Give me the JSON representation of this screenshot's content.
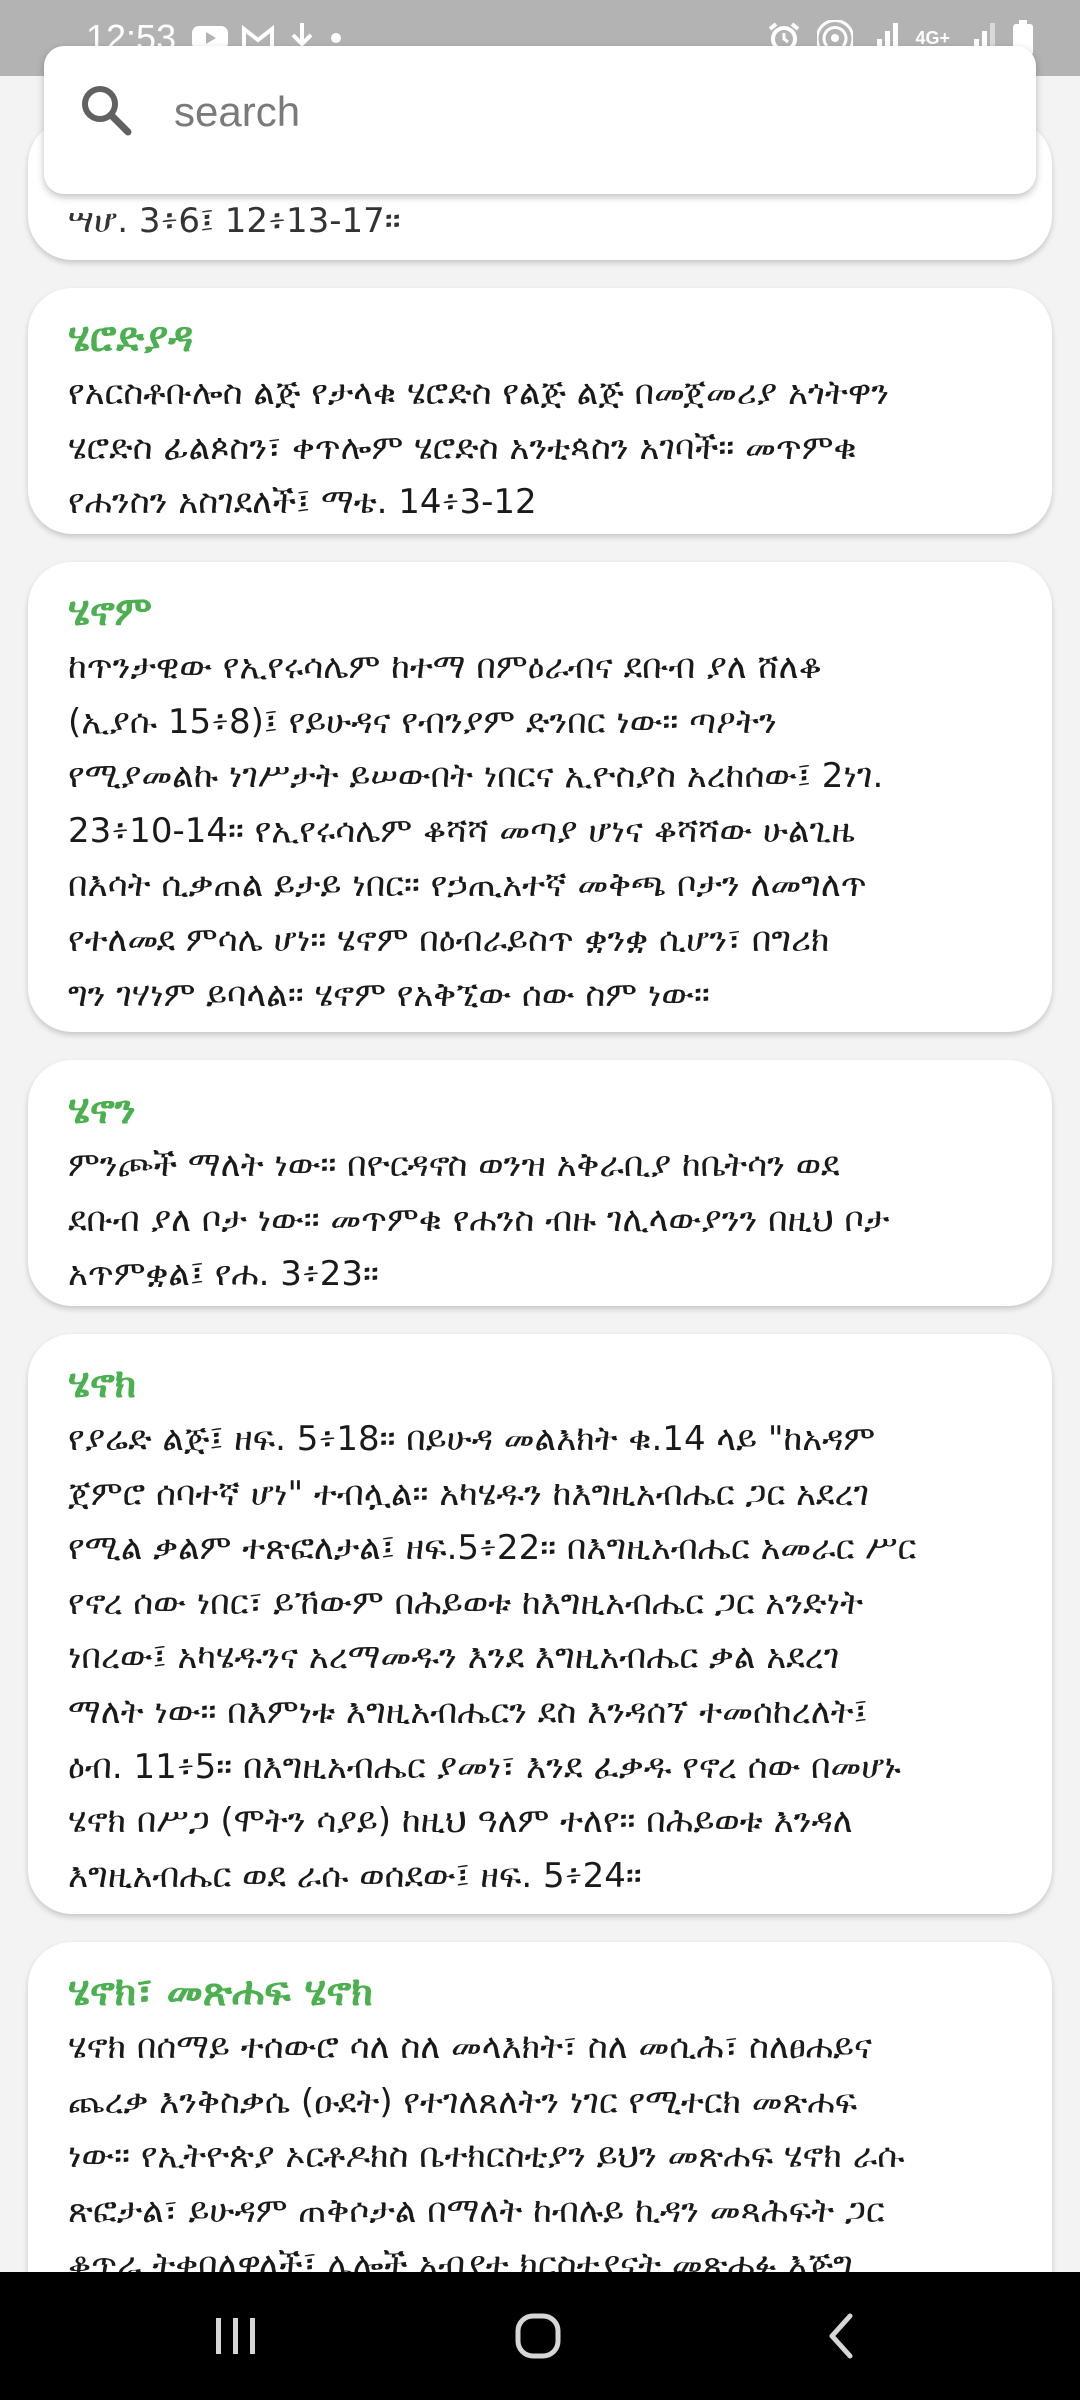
{
  "status_bar": {
    "time": "12:53",
    "network_label": "4G+"
  },
  "search": {
    "placeholder": "search"
  },
  "entries": [
    {
      "title": "",
      "lines": [
        "ሣሆ. 3፥6፤ 12፥13-17።"
      ]
    },
    {
      "title": "ሄሮድያዳ",
      "lines": [
        "የአርስቶቡሎስ ልጅ የታላቁ ሄሮድስ የልጅ ልጅ በመጀመሪያ አጎትዋን",
        "ሄሮድስ ፊልጶስን፣ ቀጥሎም ሄሮድስ አንቲጳስን አገባች። መጥምቁ",
        "የሐንስን አስገደለች፤ ማቴ. 14፥3-12"
      ]
    },
    {
      "title": "ሄኖም",
      "lines": [
        "ከጥንታዊው የኢየሩሳሌም ከተማ በምዕራብና ደቡብ ያለ ሸለቆ",
        "(ኢያሱ 15፥8)፤ የይሁዳና የብንያም ድንበር ነው። ጣዖትን",
        "የሚያመልኩ ነገሥታት ይሠውበት ነበርና ኢዮስያስ አረከሰው፤ 2ነገ.",
        "23፥10-14። የኢየሩሳሌም ቆሻሻ መጣያ ሆነና ቆሻሻው ሁልጊዜ",
        "በእሳት ሲቃጠል ይታይ ነበር። የኃጢአተኛ መቅጫ ቦታን ለመግለጥ",
        "የተለመደ ምሳሌ ሆነ። ሄኖም በዕብራይስጥ ቋንቋ ሲሆን፣ በግሪክ",
        "ግን ገሃነም ይባላል። ሄኖም የአቅኚው ሰው ስም ነው።"
      ]
    },
    {
      "title": "ሄኖን",
      "lines": [
        "ምንጮች ማለት ነው። በዮርዳኖስ ወንዝ አቅራቢያ ከቤትሳን ወደ",
        "ደቡብ ያለ ቦታ ነው። መጥምቁ የሐንስ ብዙ ገሊላውያንን በዚህ ቦታ",
        "አጥምቋል፤ የሐ. 3፥23።"
      ]
    },
    {
      "title": "ሄኖክ",
      "lines": [
        "የያሬድ ልጅ፤ ዘፍ. 5፥18። በይሁዳ መልእክት ቁ.14 ላይ \"ከአዳም",
        "ጀምሮ ሰባተኛ ሆነ\" ተብሏል። አካሄዱን ከእግዚአብሔር ጋር አደረገ",
        "የሚል ቃልም ተጽፎለታል፤ ዘፍ.5፥22። በእግዚአብሔር አመራር ሥር",
        "የኖረ ሰው ነበር፣ ይኸውም በሕይወቱ ከእግዚአብሔር ጋር አንድነት",
        "ነበረው፤ አካሄዱንና አረማመዱን እንደ እግዚአብሔር ቃል አደረገ",
        "ማለት ነው። በእምነቱ እግዚአብሔርን ደስ እንዳሰኘ ተመሰከረለት፤",
        "ዕብ. 11፥5። በእግዚአብሔር ያመነ፣ እንደ ፈቃዱ የኖረ ሰው በመሆኑ",
        "ሄኖክ በሥጋ (ሞትን ሳያይ) ከዚህ ዓለም ተለየ። በሕይወቱ እንዳለ",
        "እግዚአብሔር ወደ ራሱ ወሰደው፤ ዘፍ. 5፥24።"
      ]
    },
    {
      "title": "ሄኖክ፣ መጽሐፍ ሄኖክ",
      "lines": [
        "ሄኖክ በሰማይ ተሰውሮ ሳለ ስለ መላእክት፣ ስለ መሲሕ፣ ስለፀሐይና",
        "ጨረቃ እንቅስቃሴ (ዑደት) የተገለጸለትን ነገር የሚተርክ መጽሐፍ",
        "ነው። የኢትዮጵያ ኦርቶዶክስ ቤተክርስቲያን ይህን መጽሐፍ ሄኖክ ራሱ",
        "ጽፎታል፣ ይሁዳም ጠቅሶታል በማለት ከብሉይ ኪዳን መጻሕፍት ጋር",
        "ቆጥራ ትቀበለዋለች፤ ሌሎች አብያተ ክርስቲያናት መጽሐፉ እጅግ"
      ]
    }
  ],
  "colors": {
    "accent": "#4caf50",
    "status_bar": "#b3b3b3",
    "background": "#f3f3f3",
    "nav_bar": "#000000"
  },
  "icons": {
    "search": "search-icon",
    "nav_recent": "recent-apps-icon",
    "nav_home": "home-icon",
    "nav_back": "back-icon"
  }
}
